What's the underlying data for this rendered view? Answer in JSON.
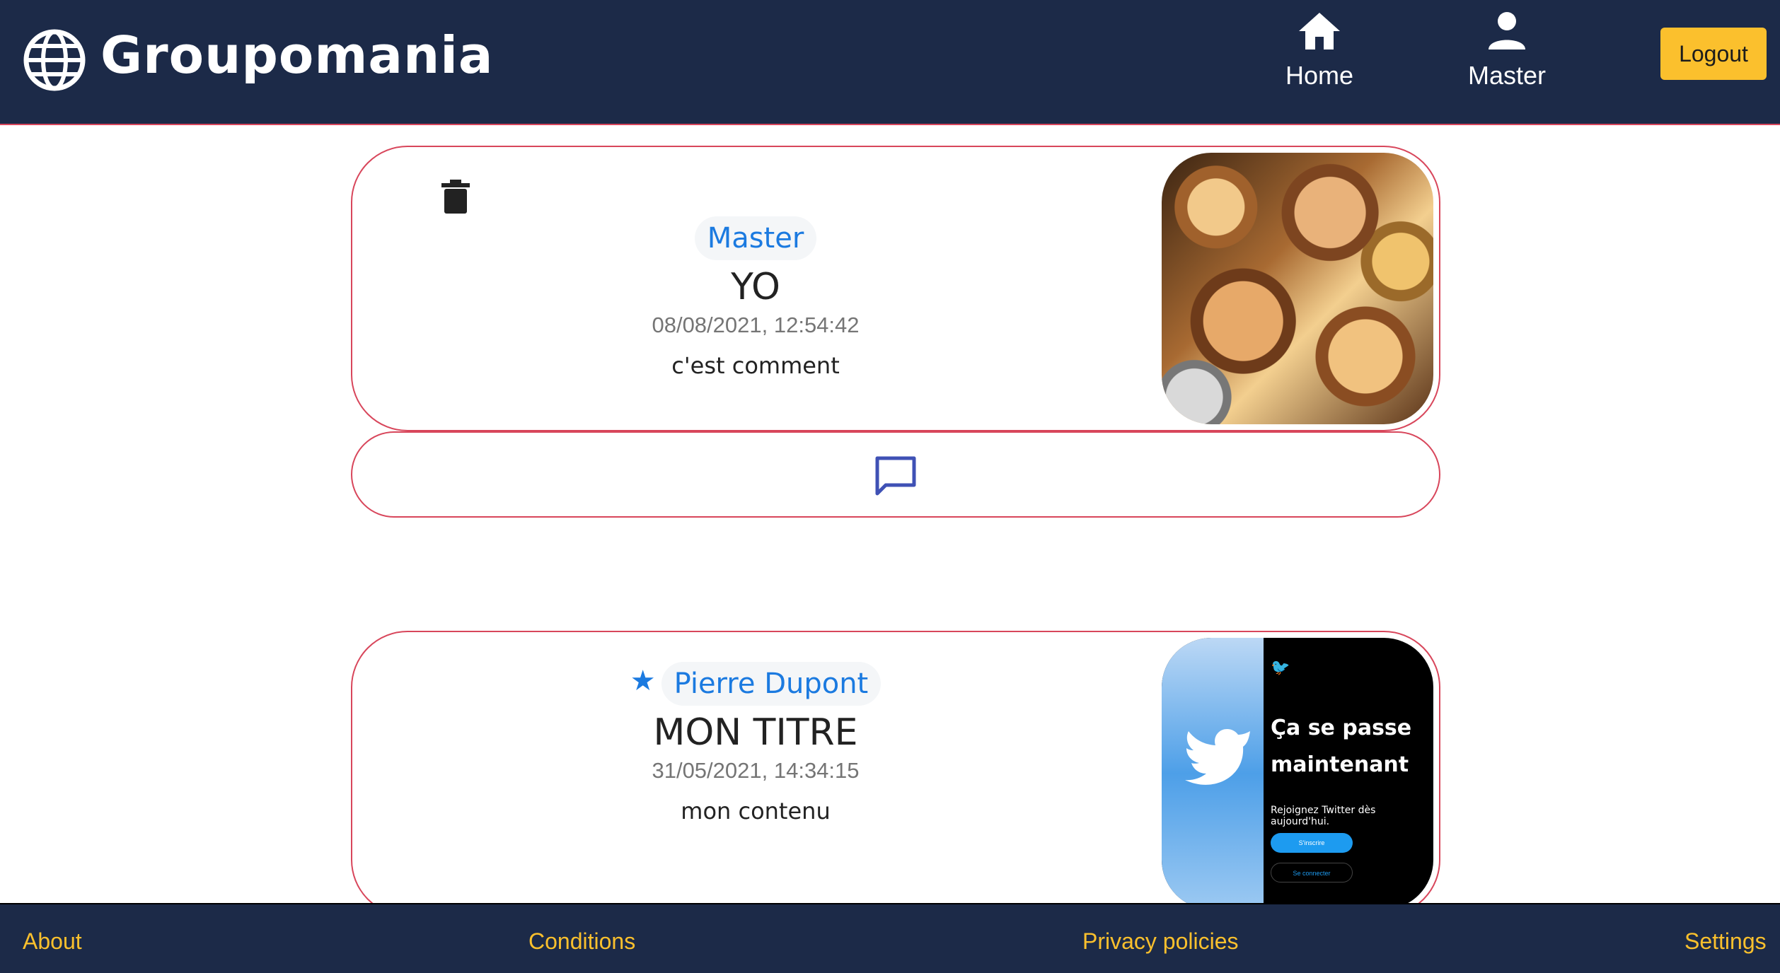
{
  "header": {
    "brand": "Groupomania",
    "nav": {
      "home_label": "Home",
      "profile_label": "Master"
    },
    "logout_label": "Logout"
  },
  "posts": [
    {
      "author": "Master",
      "title": "YO",
      "date": "08/08/2021, 12:54:42",
      "content": "c'est comment",
      "image": "crypto coins"
    },
    {
      "author": "Pierre Dupont",
      "title": "MON TITRE",
      "date": "31/05/2021, 14:34:15",
      "content": "mon contenu",
      "image_text": {
        "heading": "Ça se passe maintenant",
        "sub": "Rejoignez Twitter dès aujourd'hui.",
        "btn1": "S'inscrire",
        "btn2": "Se connecter"
      }
    }
  ],
  "footer": {
    "about": "About",
    "conditions": "Conditions",
    "privacy": "Privacy policies",
    "settings": "Settings"
  },
  "colors": {
    "header_bg": "#1c2a48",
    "accent": "#fbc02d",
    "post_border": "#d8465b",
    "author_blue": "#1b7ae0",
    "comment_icon": "#3f51b5"
  },
  "icons": [
    "globe-icon",
    "home-icon",
    "user-icon",
    "trash-icon",
    "star-icon",
    "comment-icon"
  ]
}
